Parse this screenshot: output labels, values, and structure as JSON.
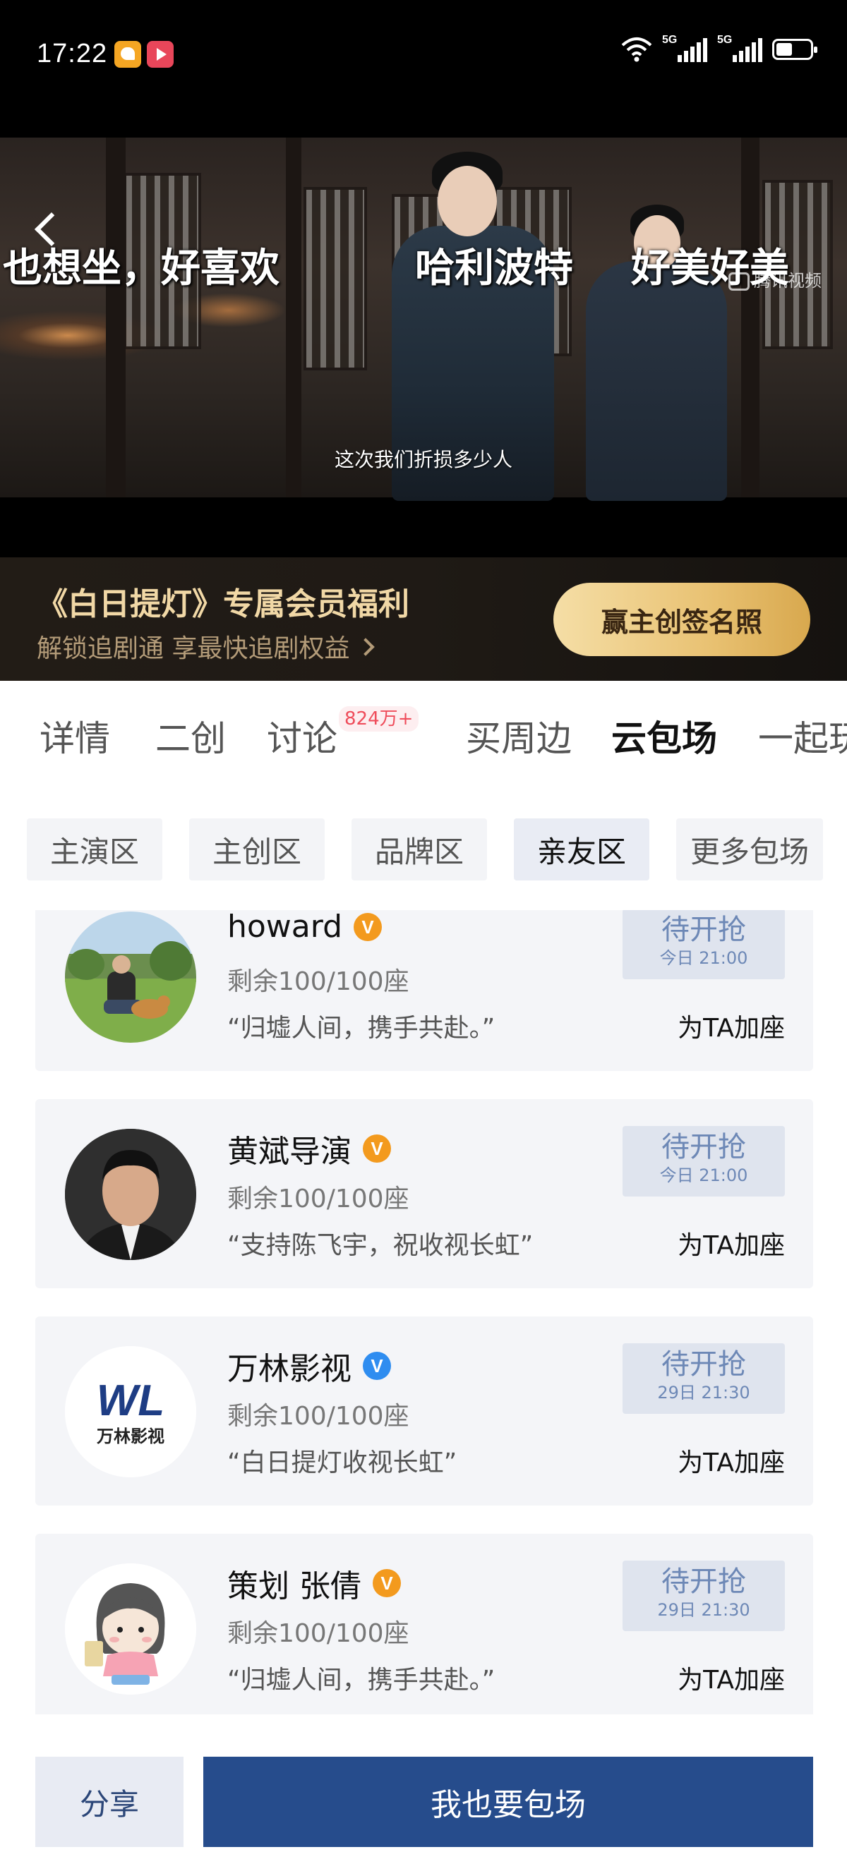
{
  "status_bar": {
    "time": "17:22",
    "network_1": "5G",
    "network_2": "5G"
  },
  "video": {
    "danmaku": [
      "也想坐，好喜欢",
      "哈利波特",
      "好美好美"
    ],
    "watermark": "腾讯视频",
    "subtitle": "这次我们折损多少人"
  },
  "promo": {
    "title": "《白日提灯》专属会员福利",
    "subtitle": "解锁追剧通 享最快追剧权益",
    "button": "赢主创签名照"
  },
  "tabs": [
    {
      "label": "详情"
    },
    {
      "label": "二创"
    },
    {
      "label": "讨论",
      "badge": "824万+"
    },
    {
      "label": "买周边"
    },
    {
      "label": "云包场",
      "active": true
    },
    {
      "label": "一起玩"
    }
  ],
  "subtabs": [
    {
      "label": "主演区"
    },
    {
      "label": "主创区"
    },
    {
      "label": "品牌区"
    },
    {
      "label": "亲友区",
      "active": true
    },
    {
      "label": "更多包场"
    }
  ],
  "cards": [
    {
      "name": "howard",
      "verified_color": "orange",
      "seats": "剩余100/100座",
      "quote": "“归墟人间，携手共赴。”",
      "status": "待开抢",
      "time": "今日 21:00",
      "action": "为TA加座"
    },
    {
      "name": "黄斌导演",
      "verified_color": "orange",
      "seats": "剩余100/100座",
      "quote": "“支持陈飞宇，祝收视长虹”",
      "status": "待开抢",
      "time": "今日 21:00",
      "action": "为TA加座"
    },
    {
      "name": "万林影视",
      "verified_color": "blue",
      "avatar_logo": "WL",
      "avatar_text": "万林影视",
      "seats": "剩余100/100座",
      "quote": "“白日提灯收视长虹”",
      "status": "待开抢",
      "time": "29日 21:30",
      "action": "为TA加座"
    },
    {
      "name": "策划 张倩",
      "verified_color": "orange",
      "seats": "剩余100/100座",
      "quote": "“归墟人间，携手共赴。”",
      "status": "待开抢",
      "time": "29日 21:30",
      "action": "为TA加座"
    }
  ],
  "bottom": {
    "share": "分享",
    "book": "我也要包场"
  },
  "colors": {
    "accent": "#264c8c",
    "badge_red": "#ef4d5b",
    "gold": "#e9c273",
    "verified_orange": "#f39a1e",
    "verified_blue": "#2f8df0"
  }
}
